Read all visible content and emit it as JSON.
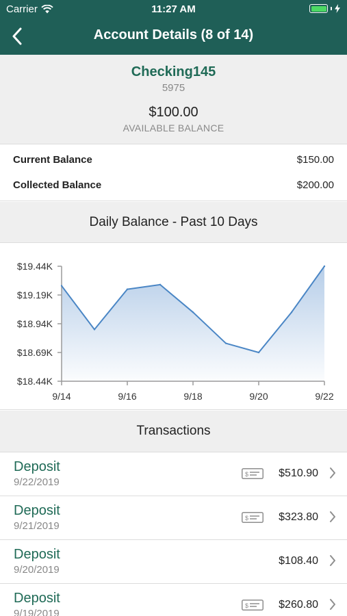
{
  "status": {
    "carrier": "Carrier",
    "time": "11:27 AM"
  },
  "nav": {
    "title": "Account Details (8 of 14)"
  },
  "account": {
    "name": "Checking145",
    "number": "5975",
    "available_amount": "$100.00",
    "available_label": "AVAILABLE BALANCE"
  },
  "balances": [
    {
      "label": "Current Balance",
      "value": "$150.00"
    },
    {
      "label": "Collected Balance",
      "value": "$200.00"
    }
  ],
  "chart_section_title": "Daily Balance - Past 10 Days",
  "transactions_title": "Transactions",
  "chart_data": {
    "type": "area",
    "x": [
      "9/14",
      "9/15",
      "9/16",
      "9/17",
      "9/18",
      "9/19",
      "9/20",
      "9/21",
      "9/22"
    ],
    "x_tick_labels": [
      "9/14",
      "9/16",
      "9/18",
      "9/20",
      "9/22"
    ],
    "values": [
      19.27,
      18.89,
      19.24,
      19.28,
      19.04,
      18.77,
      18.69,
      19.04,
      19.44
    ],
    "y_tick_labels": [
      "$19.44K",
      "$19.19K",
      "$18.94K",
      "$18.69K",
      "$18.44K"
    ],
    "y_ticks": [
      19.44,
      19.19,
      18.94,
      18.69,
      18.44
    ],
    "ylim": [
      18.44,
      19.44
    ],
    "line_color": "#4a86c5",
    "fill_color": "#aec8e6",
    "grid": false
  },
  "transactions": [
    {
      "type": "Deposit",
      "date": "9/22/2019",
      "amount": "$510.90",
      "has_check": true
    },
    {
      "type": "Deposit",
      "date": "9/21/2019",
      "amount": "$323.80",
      "has_check": true
    },
    {
      "type": "Deposit",
      "date": "9/20/2019",
      "amount": "$108.40",
      "has_check": false
    },
    {
      "type": "Deposit",
      "date": "9/19/2019",
      "amount": "$260.80",
      "has_check": true
    }
  ],
  "colors": {
    "header": "#1f5f57",
    "accent": "#1f6a56",
    "section_bg": "#efefef"
  },
  "icons": {
    "back": "chevron-left-icon",
    "check": "check-image-icon",
    "disclosure": "chevron-right-icon",
    "wifi": "wifi-icon",
    "battery": "battery-icon"
  }
}
